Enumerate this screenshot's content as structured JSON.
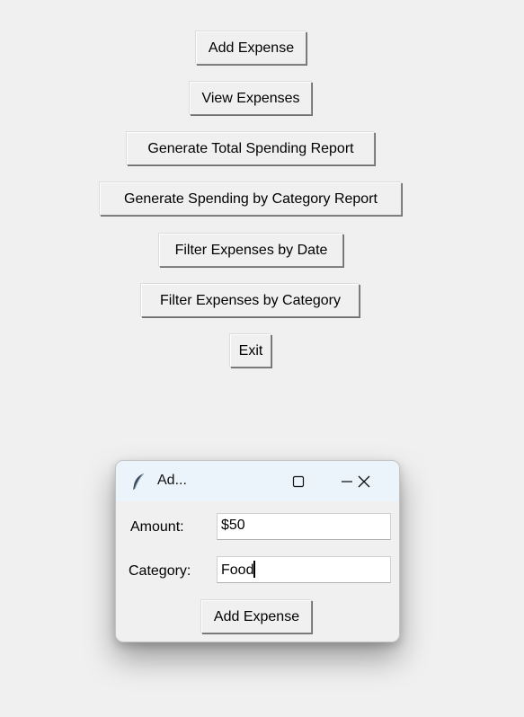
{
  "main_menu": {
    "buttons": [
      {
        "id": "add_expense",
        "label": "Add Expense"
      },
      {
        "id": "view_expenses",
        "label": "View Expenses"
      },
      {
        "id": "total_report",
        "label": "Generate Total Spending Report"
      },
      {
        "id": "category_report",
        "label": "Generate Spending by Category Report"
      },
      {
        "id": "filter_date",
        "label": "Filter Expenses by Date"
      },
      {
        "id": "filter_category",
        "label": "Filter Expenses by Category"
      },
      {
        "id": "exit",
        "label": "Exit"
      }
    ]
  },
  "dialog": {
    "title": "Ad...",
    "icon": "tk-feather-icon",
    "controls": {
      "minimize": "minimize-icon",
      "maximize": "maximize-icon",
      "close": "close-icon"
    },
    "amount": {
      "label": "Amount:",
      "value": "$50"
    },
    "category": {
      "label": "Category:",
      "value": "Food"
    },
    "submit_label": "Add Expense"
  }
}
